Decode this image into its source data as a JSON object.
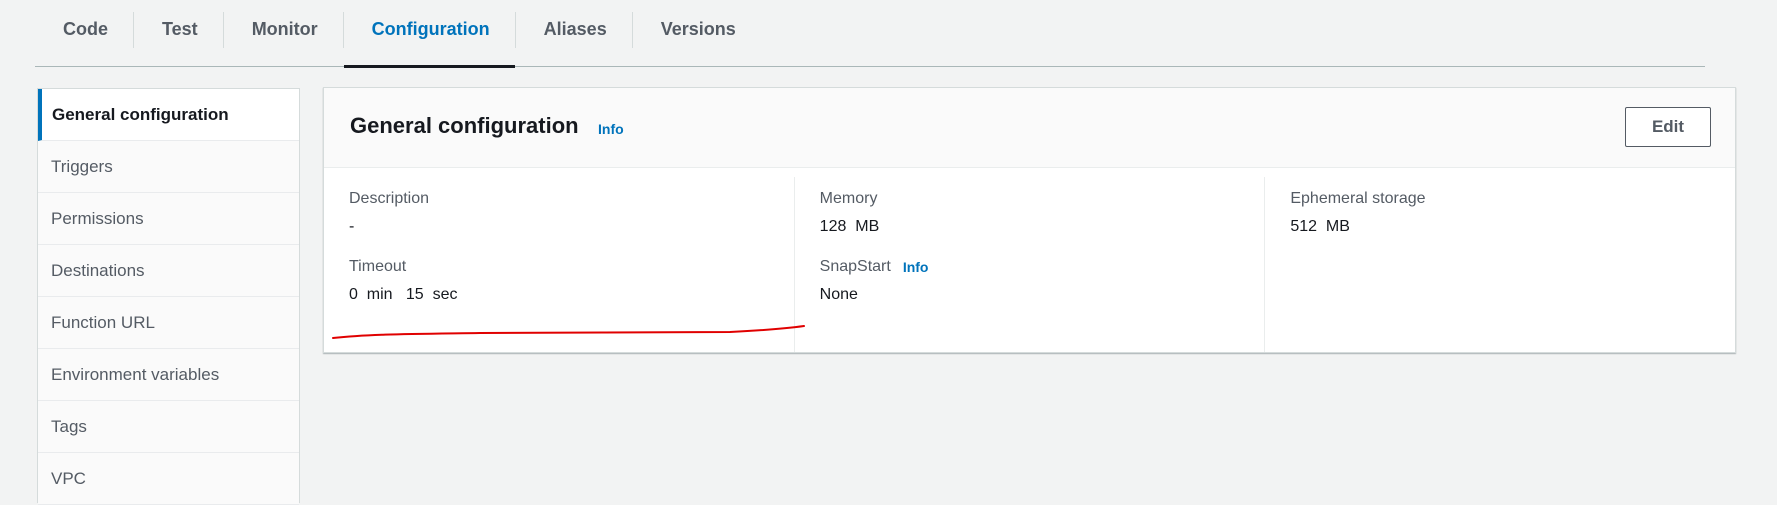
{
  "tabs": [
    {
      "label": "Code",
      "active": false
    },
    {
      "label": "Test",
      "active": false
    },
    {
      "label": "Monitor",
      "active": false
    },
    {
      "label": "Configuration",
      "active": true
    },
    {
      "label": "Aliases",
      "active": false
    },
    {
      "label": "Versions",
      "active": false
    }
  ],
  "sidebar": {
    "items": [
      {
        "label": "General configuration",
        "active": true
      },
      {
        "label": "Triggers"
      },
      {
        "label": "Permissions"
      },
      {
        "label": "Destinations"
      },
      {
        "label": "Function URL"
      },
      {
        "label": "Environment variables"
      },
      {
        "label": "Tags"
      },
      {
        "label": "VPC"
      }
    ]
  },
  "panel": {
    "title": "General configuration",
    "info_label": "Info",
    "edit_label": "Edit",
    "fields": {
      "description": {
        "label": "Description",
        "value": "-"
      },
      "timeout": {
        "label": "Timeout",
        "value": "0  min   15  sec"
      },
      "memory": {
        "label": "Memory",
        "value": "128  MB"
      },
      "snapstart": {
        "label": "SnapStart",
        "info_label": "Info",
        "value": "None"
      },
      "ephemeral_storage": {
        "label": "Ephemeral storage",
        "value": "512  MB"
      }
    }
  },
  "colors": {
    "accent": "#0073bb",
    "annotation": "#e00000"
  }
}
